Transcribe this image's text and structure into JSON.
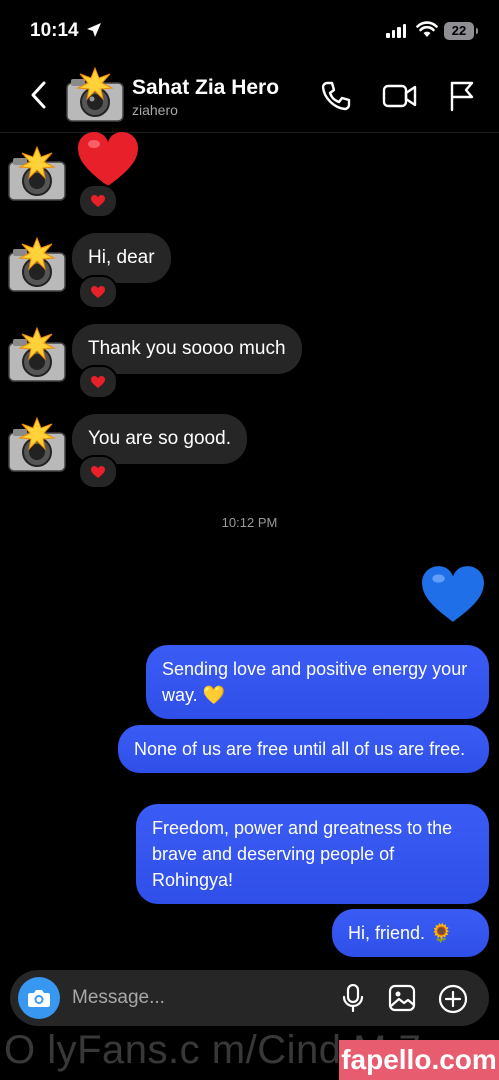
{
  "status_bar": {
    "time": "10:14",
    "battery": "22"
  },
  "header": {
    "name": "Sahat Zia Hero",
    "handle": "ziahero"
  },
  "messages_in": [
    {
      "text": "Hi, dear"
    },
    {
      "text": "Thank you soooo much"
    },
    {
      "text": "You are so good."
    }
  ],
  "timestamp": "10:12 PM",
  "messages_out": [
    {
      "text": "Sending love and positive energy your way. 💛"
    },
    {
      "text": "None of us are free until all of us are free."
    },
    {
      "text": "Freedom, power and greatness to the brave and deserving people of Rohingya!"
    },
    {
      "text": "Hi, friend. 🌻"
    }
  ],
  "composer": {
    "placeholder": "Message..."
  },
  "watermark": {
    "text": "O lyFans.c m/Cind   M    7",
    "site": "fapello.com"
  },
  "colors": {
    "outgoing_bubble": "#3a5cf5",
    "incoming_bubble": "#262626",
    "camera_button": "#3897f0",
    "heart": "#e8202a",
    "blue_heart": "#1e6fe8"
  }
}
